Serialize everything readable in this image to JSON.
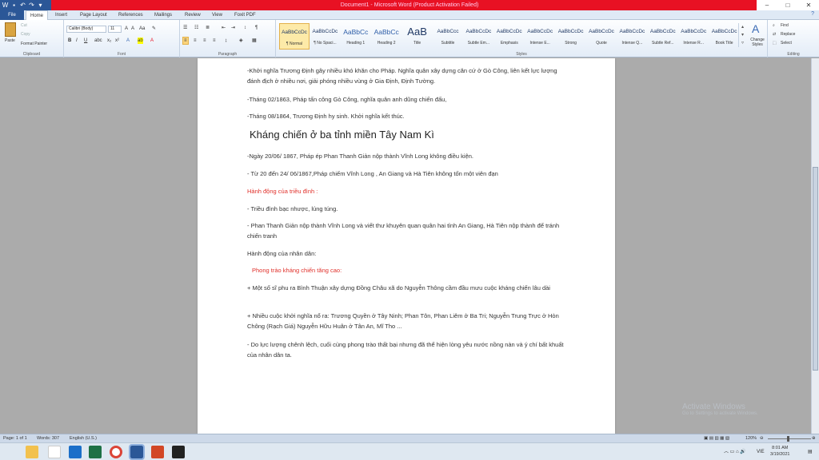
{
  "window": {
    "title": "Document1 - Microsoft Word (Product Activation Failed)"
  },
  "ribbon_tabs": [
    "File",
    "Home",
    "Insert",
    "Page Layout",
    "References",
    "Mailings",
    "Review",
    "View",
    "Foxit PDF"
  ],
  "clipboard": {
    "paste": "Paste",
    "cut": "Cut",
    "copy": "Copy",
    "format_painter": "Format Painter",
    "label": "Clipboard"
  },
  "font": {
    "family": "Calibri (Body)",
    "size": "11",
    "label": "Font"
  },
  "paragraph": {
    "label": "Paragraph"
  },
  "styles": {
    "label": "Styles",
    "items": [
      {
        "preview": "AaBbCcDc",
        "name": "¶ Normal"
      },
      {
        "preview": "AaBbCcDc",
        "name": "¶ No Spaci..."
      },
      {
        "preview": "AaBbCc",
        "name": "Heading 1"
      },
      {
        "preview": "AaBbCc",
        "name": "Heading 2"
      },
      {
        "preview": "AaB",
        "name": "Title"
      },
      {
        "preview": "AaBbCcc",
        "name": "Subtitle"
      },
      {
        "preview": "AaBbCcDc",
        "name": "Subtle Em..."
      },
      {
        "preview": "AaBbCcDc",
        "name": "Emphasis"
      },
      {
        "preview": "AaBbCcDc",
        "name": "Intense E..."
      },
      {
        "preview": "AaBbCcDc",
        "name": "Strong"
      },
      {
        "preview": "AaBbCcDc",
        "name": "Quote"
      },
      {
        "preview": "AaBbCcDc",
        "name": "Intense Q..."
      },
      {
        "preview": "AaBbCcDc",
        "name": "Subtle Ref..."
      },
      {
        "preview": "AaBbCcDc",
        "name": "Intense R..."
      },
      {
        "preview": "AaBbCcDc",
        "name": "Book Title"
      }
    ],
    "change_styles": "Change Styles"
  },
  "editing": {
    "find": "Find",
    "replace": "Replace",
    "select": "Select",
    "label": "Editing"
  },
  "document": {
    "paragraphs": [
      {
        "text": "-Khởi nghĩa Trương Định gây nhiều khó khăn cho Pháp. Nghĩa quân xây dựng căn cứ ở Gò Công, liên kết lực lượng đánh địch ở nhiều nơi, giải phóng nhiều vùng ở Gia Định, Định Tường.",
        "color": "normal"
      },
      {
        "text": "-Tháng 02/1863, Pháp tấn công Gò Công, nghĩa quân anh dũng chiến đấu,",
        "color": "normal"
      },
      {
        "text": "-Tháng 08/1864, Trương Định hy sinh. Khởi nghĩa kết thúc.",
        "color": "normal"
      },
      {
        "text": "Kháng chiến ở ba tỉnh miền Tây Nam Kì",
        "color": "heading"
      },
      {
        "text": "-Ngày 20/06/ 1867, Pháp ép Phan Thanh Giản nộp thành Vĩnh Long không điều kiện.",
        "color": "normal"
      },
      {
        "text": "- Từ 20 đến 24/ 06/1867,Pháp chiếm Vĩnh Long , An Giang và Hà Tiên không tốn một viên đạn",
        "color": "normal"
      },
      {
        "text": "Hành động của triều đình :",
        "color": "red"
      },
      {
        "text": "- Triều đình bạc nhược, lúng túng.",
        "color": "normal"
      },
      {
        "text": "- Phan Thanh Giản nộp thành Vĩnh Long và viết thư khuyên quan quân hai tỉnh An Giang, Hà Tiên nộp thành để tránh chiến tranh",
        "color": "normal"
      },
      {
        "text": "Hành động của nhân dân:",
        "color": "normal"
      },
      {
        "text": "Phong trào kháng chiến tăng cao:",
        "color": "red"
      },
      {
        "text": "+ Một số sĩ phu ra Bình Thuận xây dựng Đồng Châu xã do Nguyễn Thông cầm đầu mưu cuộc kháng chiến lâu dài",
        "color": "normal"
      },
      {
        "text": "+ Nhiều cuộc khởi nghĩa nổ ra: Trương Quyền ở Tây Ninh; Phan Tôn, Phan Liêm ở Ba Tri; Nguyễn Trung Trực ở Hòn Chông (Rạch Giá) Nguyễn Hữu Huân ở Tân An, Mĩ Tho ...",
        "color": "normal"
      },
      {
        "text": "- Do lực lượng chênh lệch, cuối cùng phong trào thất bại nhưng đã thể hiện lòng yêu nước nồng nàn và ý chí bất khuất của nhân dân ta.",
        "color": "normal"
      }
    ]
  },
  "status": {
    "page": "Page: 1 of 1",
    "words": "Words: 307",
    "language": "English (U.S.)",
    "zoom": "120%"
  },
  "watermark": {
    "line1": "Activate Windows",
    "line2": "Go to Settings to activate Windows."
  },
  "taskbar": {
    "language": "VIE",
    "time": "8:01 AM",
    "date": "3/19/2021"
  },
  "colors": {
    "titlebar": "#e81123",
    "red_text": "#e0302a",
    "file_tab": "#2b5797"
  }
}
